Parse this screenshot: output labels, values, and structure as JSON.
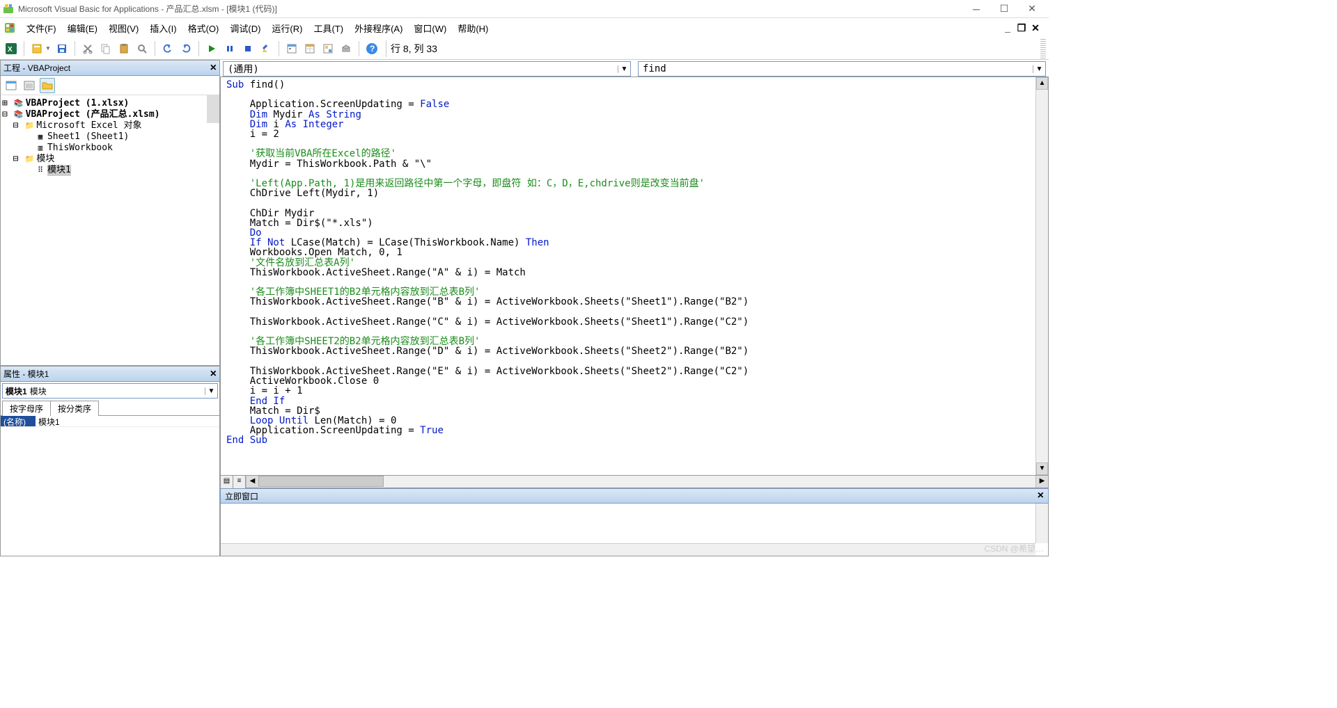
{
  "title": "Microsoft Visual Basic for Applications - 产品汇总.xlsm - [模块1 (代码)]",
  "menus": [
    "文件(F)",
    "编辑(E)",
    "视图(V)",
    "插入(I)",
    "格式(O)",
    "调试(D)",
    "运行(R)",
    "工具(T)",
    "外接程序(A)",
    "窗口(W)",
    "帮助(H)"
  ],
  "status_position": "行 8, 列 33",
  "project_panel": {
    "title": "工程 - VBAProject"
  },
  "tree": {
    "p1": "VBAProject (1.xlsx)",
    "p2": "VBAProject (产品汇总.xlsm)",
    "grp1": "Microsoft Excel 对象",
    "n1": "Sheet1 (Sheet1)",
    "n2": "ThisWorkbook",
    "grp2": "模块",
    "m1": "模块1"
  },
  "properties_panel": {
    "title": "属性 - 模块1",
    "object_name": "模块1",
    "object_type": "模块",
    "tabs": [
      "按字母序",
      "按分类序"
    ],
    "rows": [
      {
        "k": "(名称)",
        "v": "模块1"
      }
    ]
  },
  "code_combo_left": "(通用)",
  "code_combo_right": "find",
  "immediate_title": "立即窗口",
  "watermark": "CSDN @希望…",
  "code": {
    "l1a": "Sub",
    "l1b": " find()",
    "l2": "    Application.ScreenUpdating = ",
    "l2b": "False",
    "l3a": "    Dim",
    "l3b": " Mydir ",
    "l3c": "As String",
    "l4a": "    Dim",
    "l4b": " i ",
    "l4c": "As Integer",
    "l5": "    i = 2",
    "l6": "    '获取当前VBA所在Excel的路径'",
    "l7": "    Mydir = ThisWorkbook.Path & \"\\\"",
    "l8": "    'Left(App.Path, 1)是用来返回路径中第一个字母，即盘符 如：C，D，E,chdrive则是改变当前盘'",
    "l9": "    ChDrive Left(Mydir, 1)",
    "l10": "    ChDir Mydir",
    "l11": "    Match = Dir$(\"*.xls\")",
    "l12": "    Do",
    "l13a": "    If Not",
    "l13b": " LCase(Match) = LCase(ThisWorkbook.Name) ",
    "l13c": "Then",
    "l14": "    Workbooks.Open Match, 0, 1",
    "l15": "    '文件名放到汇总表A列'",
    "l16": "    ThisWorkbook.ActiveSheet.Range(\"A\" & i) = Match",
    "l17": "    '各工作簿中SHEET1的B2单元格内容放到汇总表B列'",
    "l18": "    ThisWorkbook.ActiveSheet.Range(\"B\" & i) = ActiveWorkbook.Sheets(\"Sheet1\").Range(\"B2\")",
    "l19": "    ThisWorkbook.ActiveSheet.Range(\"C\" & i) = ActiveWorkbook.Sheets(\"Sheet1\").Range(\"C2\")",
    "l20": "    '各工作簿中SHEET2的B2单元格内容放到汇总表B列'",
    "l21": "    ThisWorkbook.ActiveSheet.Range(\"D\" & i) = ActiveWorkbook.Sheets(\"Sheet2\").Range(\"B2\")",
    "l22": "    ThisWorkbook.ActiveSheet.Range(\"E\" & i) = ActiveWorkbook.Sheets(\"Sheet2\").Range(\"C2\")",
    "l23": "    ActiveWorkbook.Close 0",
    "l24": "    i = i + 1",
    "l25": "    End If",
    "l26": "    Match = Dir$",
    "l27a": "    Loop Until",
    "l27b": " Len(Match) = 0",
    "l28": "    Application.ScreenUpdating = ",
    "l28b": "True",
    "l29": "End Sub"
  }
}
